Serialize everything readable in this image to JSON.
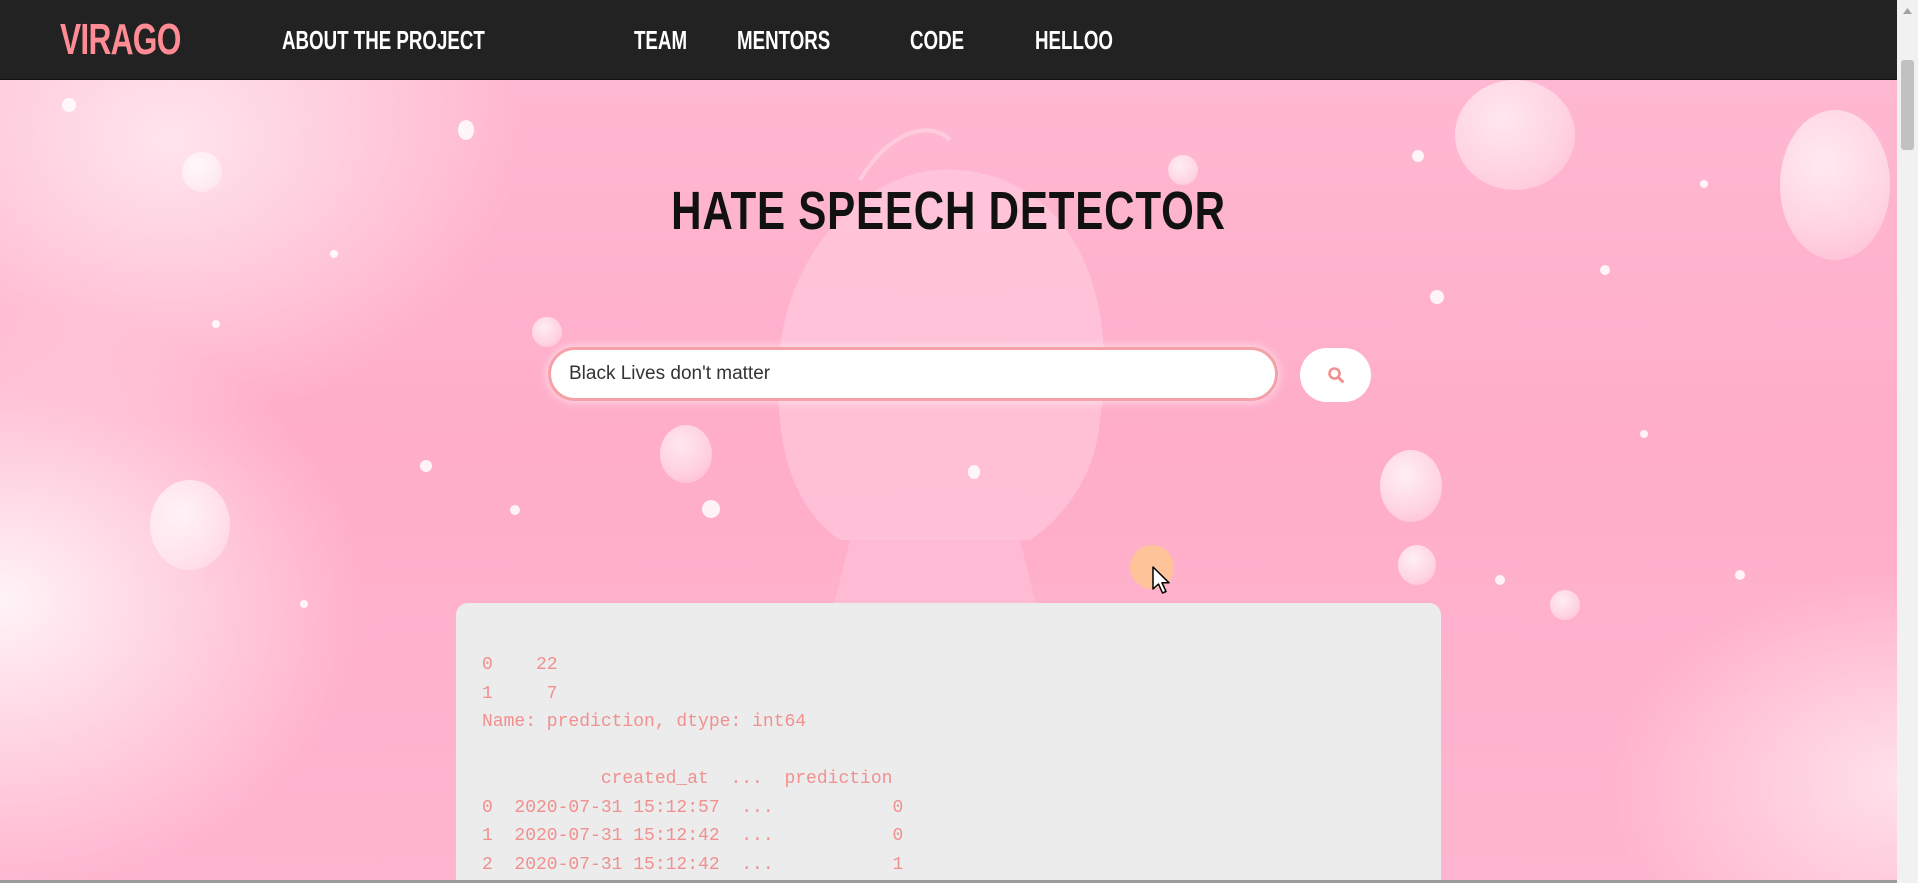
{
  "navbar": {
    "brand": "VIRAGO",
    "links": [
      {
        "label": "ABOUT THE PROJECT"
      },
      {
        "label": "TEAM"
      },
      {
        "label": "MENTORS"
      },
      {
        "label": "CODE"
      },
      {
        "label": "HELLOO"
      }
    ]
  },
  "hero": {
    "title": "HATE SPEECH DETECTOR"
  },
  "search": {
    "value": "Black Lives don't matter",
    "button_icon": "search-icon"
  },
  "results": {
    "lines": [
      "0    22",
      "1     7",
      "Name: prediction, dtype: int64",
      "",
      "           created_at  ...  prediction",
      "0  2020-07-31 15:12:57  ...           0",
      "1  2020-07-31 15:12:42  ...           0",
      "2  2020-07-31 15:12:42  ...           1"
    ]
  },
  "colors": {
    "brand": "#ff8c94",
    "navbar_bg": "#222222",
    "hero_pink": "#ffb5cf",
    "result_text": "#f0908f",
    "panel_bg": "#ececec"
  }
}
